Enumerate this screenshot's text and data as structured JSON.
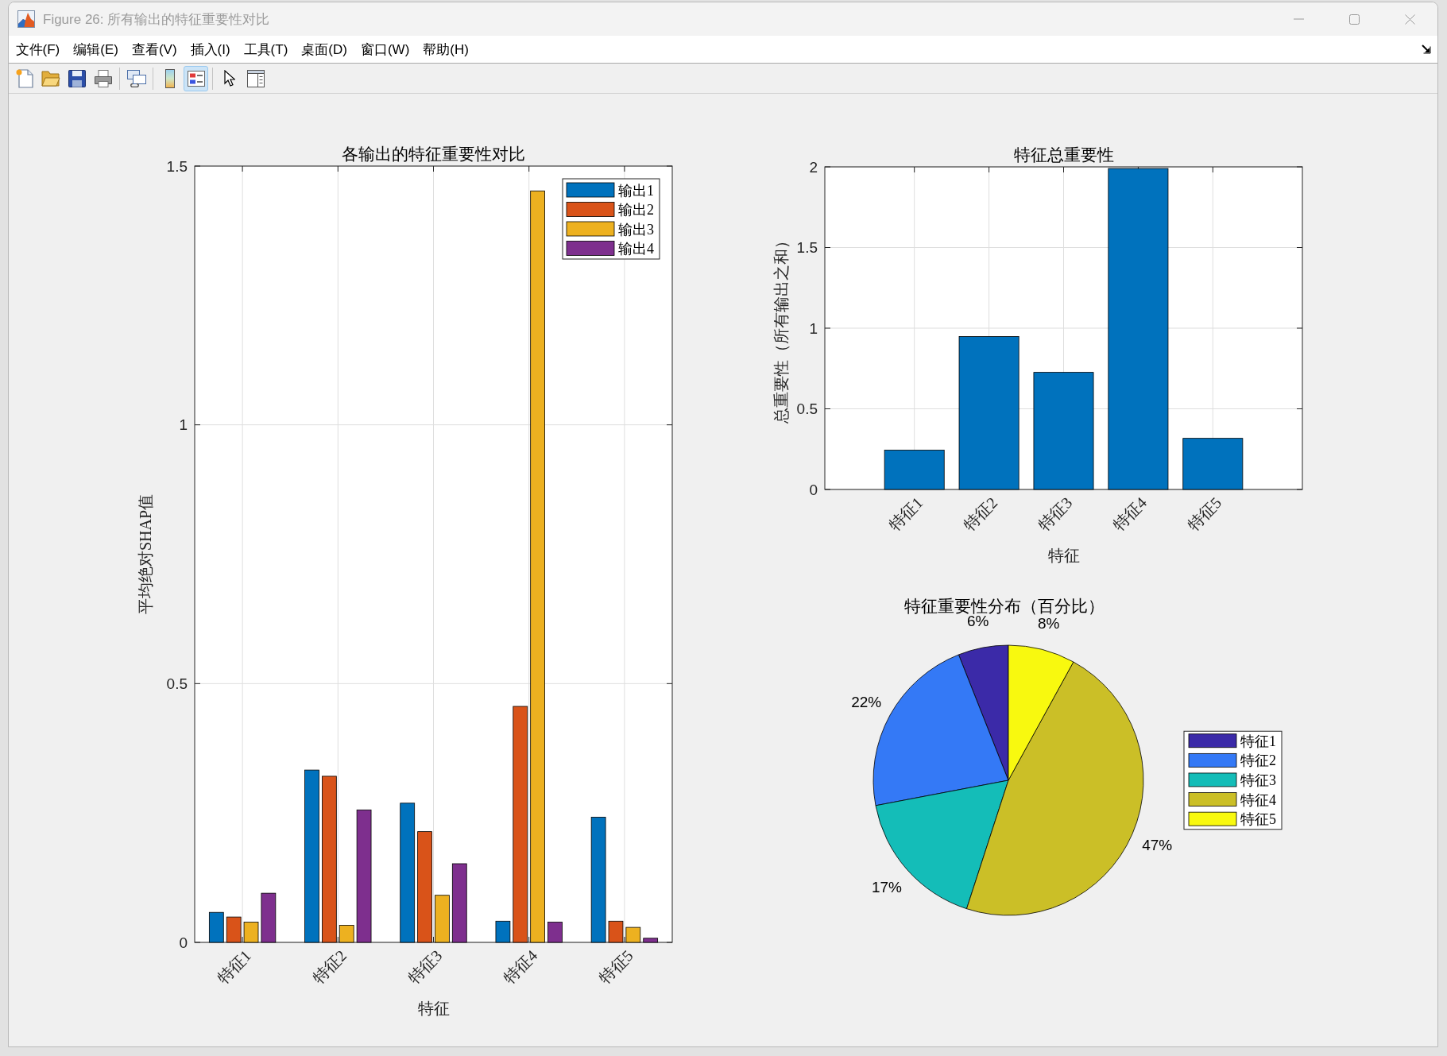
{
  "window": {
    "title": "Figure 26: 所有输出的特征重要性对比",
    "active": false
  },
  "menu_bar": {
    "items": [
      "文件(F)",
      "编辑(E)",
      "查看(V)",
      "插入(I)",
      "工具(T)",
      "桌面(D)",
      "窗口(W)",
      "帮助(H)"
    ]
  },
  "toolbar": {
    "groups": [
      [
        {
          "kind": "new",
          "pressed": false
        },
        {
          "kind": "open",
          "pressed": false
        },
        {
          "kind": "save",
          "pressed": false
        },
        {
          "kind": "print",
          "pressed": false
        }
      ],
      [
        {
          "kind": "link",
          "pressed": false
        }
      ],
      [
        {
          "kind": "colorbar",
          "pressed": false
        },
        {
          "kind": "legend",
          "pressed": true
        }
      ],
      [
        {
          "kind": "pointer",
          "pressed": false
        },
        {
          "kind": "inspector",
          "pressed": false
        }
      ]
    ]
  },
  "figure": {
    "comparison_chart": {
      "chart_data": {
        "type": "bar",
        "title": "各输出的特征重要性对比",
        "xlabel": "特征",
        "ylabel": "平均绝对SHAP值",
        "categories": [
          "特征1",
          "特征2",
          "特征3",
          "特征4",
          "特征5"
        ],
        "series": [
          {
            "name": "输出1",
            "color": "#0072bd",
            "values": [
              0.058,
              0.333,
              0.269,
              0.041,
              0.242
            ]
          },
          {
            "name": "输出2",
            "color": "#d95319",
            "values": [
              0.049,
              0.321,
              0.214,
              0.456,
              0.041
            ]
          },
          {
            "name": "输出3",
            "color": "#edb120",
            "values": [
              0.039,
              0.033,
              0.091,
              1.452,
              0.029
            ]
          },
          {
            "name": "输出4",
            "color": "#7e2f8e",
            "values": [
              0.095,
              0.256,
              0.152,
              0.039,
              0.008
            ]
          }
        ],
        "ylim": [
          0,
          1.5
        ],
        "yticks": [
          0,
          0.5,
          1,
          1.5
        ],
        "grid": true,
        "legend": true
      }
    },
    "total_chart": {
      "chart_data": {
        "type": "bar",
        "title": "特征总重要性",
        "xlabel": "特征",
        "ylabel": "总重要性（所有输出之和）",
        "categories": [
          "特征1",
          "特征2",
          "特征3",
          "特征4",
          "特征5"
        ],
        "series": [
          {
            "color": "#0072bd",
            "values": [
              0.244,
              0.948,
              0.726,
              1.99,
              0.317
            ]
          }
        ],
        "ylim": [
          0,
          2
        ],
        "yticks": [
          0,
          0.5,
          1,
          1.5,
          2
        ],
        "grid": true
      }
    },
    "share_chart": {
      "chart_data": {
        "type": "pie",
        "title": "特征重要性分布（百分比）",
        "categories": [
          "特征1",
          "特征2",
          "特征3",
          "特征4",
          "特征5"
        ],
        "values": [
          6,
          22,
          17,
          47,
          8
        ],
        "colors": [
          "#3b2aa8",
          "#3479f6",
          "#14bdb8",
          "#cbbf27",
          "#f8f90f"
        ],
        "value_labels": [
          "6%",
          "22%",
          "17%",
          "47%",
          "8%"
        ],
        "legend": true
      }
    }
  }
}
